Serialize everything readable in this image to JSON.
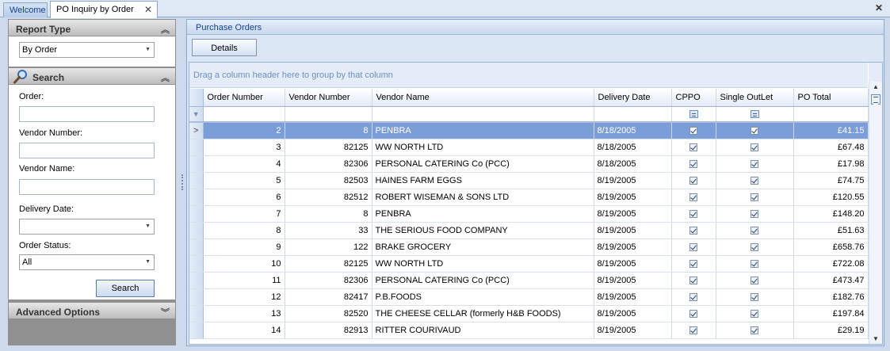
{
  "tabs": [
    {
      "label": "Welcome"
    },
    {
      "label": "PO Inquiry by Order"
    }
  ],
  "tab_close_glyph": "✕",
  "window_close_glyph": "✕",
  "left_panel": {
    "report_type": {
      "header": "Report Type",
      "selected": "By Order"
    },
    "search": {
      "header": "Search",
      "order_label": "Order:",
      "order_value": "",
      "vendor_number_label": "Vendor Number:",
      "vendor_number_value": "",
      "vendor_name_label": "Vendor Name:",
      "vendor_name_value": "",
      "delivery_date_label": "Delivery Date:",
      "delivery_date_value": "",
      "order_status_label": "Order Status:",
      "order_status_value": "All",
      "search_button": "Search"
    },
    "advanced": {
      "header": "Advanced Options"
    }
  },
  "right_panel": {
    "title": "Purchase Orders",
    "details_button": "Details",
    "group_hint": "Drag a column header here to group by that column",
    "columns": [
      "Order Number",
      "Vendor Number",
      "Vendor Name",
      "Delivery Date",
      "CPPO",
      "Single OutLet",
      "PO Total"
    ],
    "rows": [
      {
        "order": "2",
        "vendor_no": "8",
        "vendor_name": "PENBRA",
        "date": "8/18/2005",
        "cppo": true,
        "single": true,
        "total": "£41.15",
        "selected": true
      },
      {
        "order": "3",
        "vendor_no": "82125",
        "vendor_name": "WW NORTH LTD",
        "date": "8/18/2005",
        "cppo": true,
        "single": true,
        "total": "£67.48"
      },
      {
        "order": "4",
        "vendor_no": "82306",
        "vendor_name": "PERSONAL CATERING Co (PCC)",
        "date": "8/18/2005",
        "cppo": true,
        "single": true,
        "total": "£17.98"
      },
      {
        "order": "5",
        "vendor_no": "82503",
        "vendor_name": "HAINES FARM EGGS",
        "date": "8/19/2005",
        "cppo": true,
        "single": true,
        "total": "£74.75"
      },
      {
        "order": "6",
        "vendor_no": "82512",
        "vendor_name": "ROBERT WISEMAN & SONS LTD",
        "date": "8/19/2005",
        "cppo": true,
        "single": true,
        "total": "£120.55"
      },
      {
        "order": "7",
        "vendor_no": "8",
        "vendor_name": "PENBRA",
        "date": "8/19/2005",
        "cppo": true,
        "single": true,
        "total": "£148.20"
      },
      {
        "order": "8",
        "vendor_no": "33",
        "vendor_name": "THE SERIOUS FOOD COMPANY",
        "date": "8/19/2005",
        "cppo": true,
        "single": true,
        "total": "£51.63"
      },
      {
        "order": "9",
        "vendor_no": "122",
        "vendor_name": "BRAKE GROCERY",
        "date": "8/19/2005",
        "cppo": true,
        "single": true,
        "total": "£658.76"
      },
      {
        "order": "10",
        "vendor_no": "82125",
        "vendor_name": "WW NORTH LTD",
        "date": "8/19/2005",
        "cppo": true,
        "single": true,
        "total": "£722.08"
      },
      {
        "order": "11",
        "vendor_no": "82306",
        "vendor_name": "PERSONAL CATERING Co (PCC)",
        "date": "8/19/2005",
        "cppo": true,
        "single": true,
        "total": "£473.47"
      },
      {
        "order": "12",
        "vendor_no": "82417",
        "vendor_name": "P.B.FOODS",
        "date": "8/19/2005",
        "cppo": true,
        "single": true,
        "total": "£182.76"
      },
      {
        "order": "13",
        "vendor_no": "82520",
        "vendor_name": "THE CHEESE CELLAR (formerly H&B FOODS)",
        "date": "8/19/2005",
        "cppo": true,
        "single": true,
        "total": "£197.84"
      },
      {
        "order": "14",
        "vendor_no": "82913",
        "vendor_name": "RITTER COURIVAUD",
        "date": "8/19/2005",
        "cppo": true,
        "single": true,
        "total": "£29.19"
      }
    ]
  },
  "icons": {
    "collapse": "chevron-double-up-icon",
    "expand": "chevron-double-down-icon",
    "search": "magnifier-icon",
    "dropdown": "dropdown-arrow-icon",
    "row_indicator": "current-row-arrow-icon",
    "filter": "filter-icon"
  },
  "colors": {
    "selected_row": "#7c9ed8",
    "panel_header_text": "#15428b",
    "group_hint_text": "#6d8fbf"
  }
}
